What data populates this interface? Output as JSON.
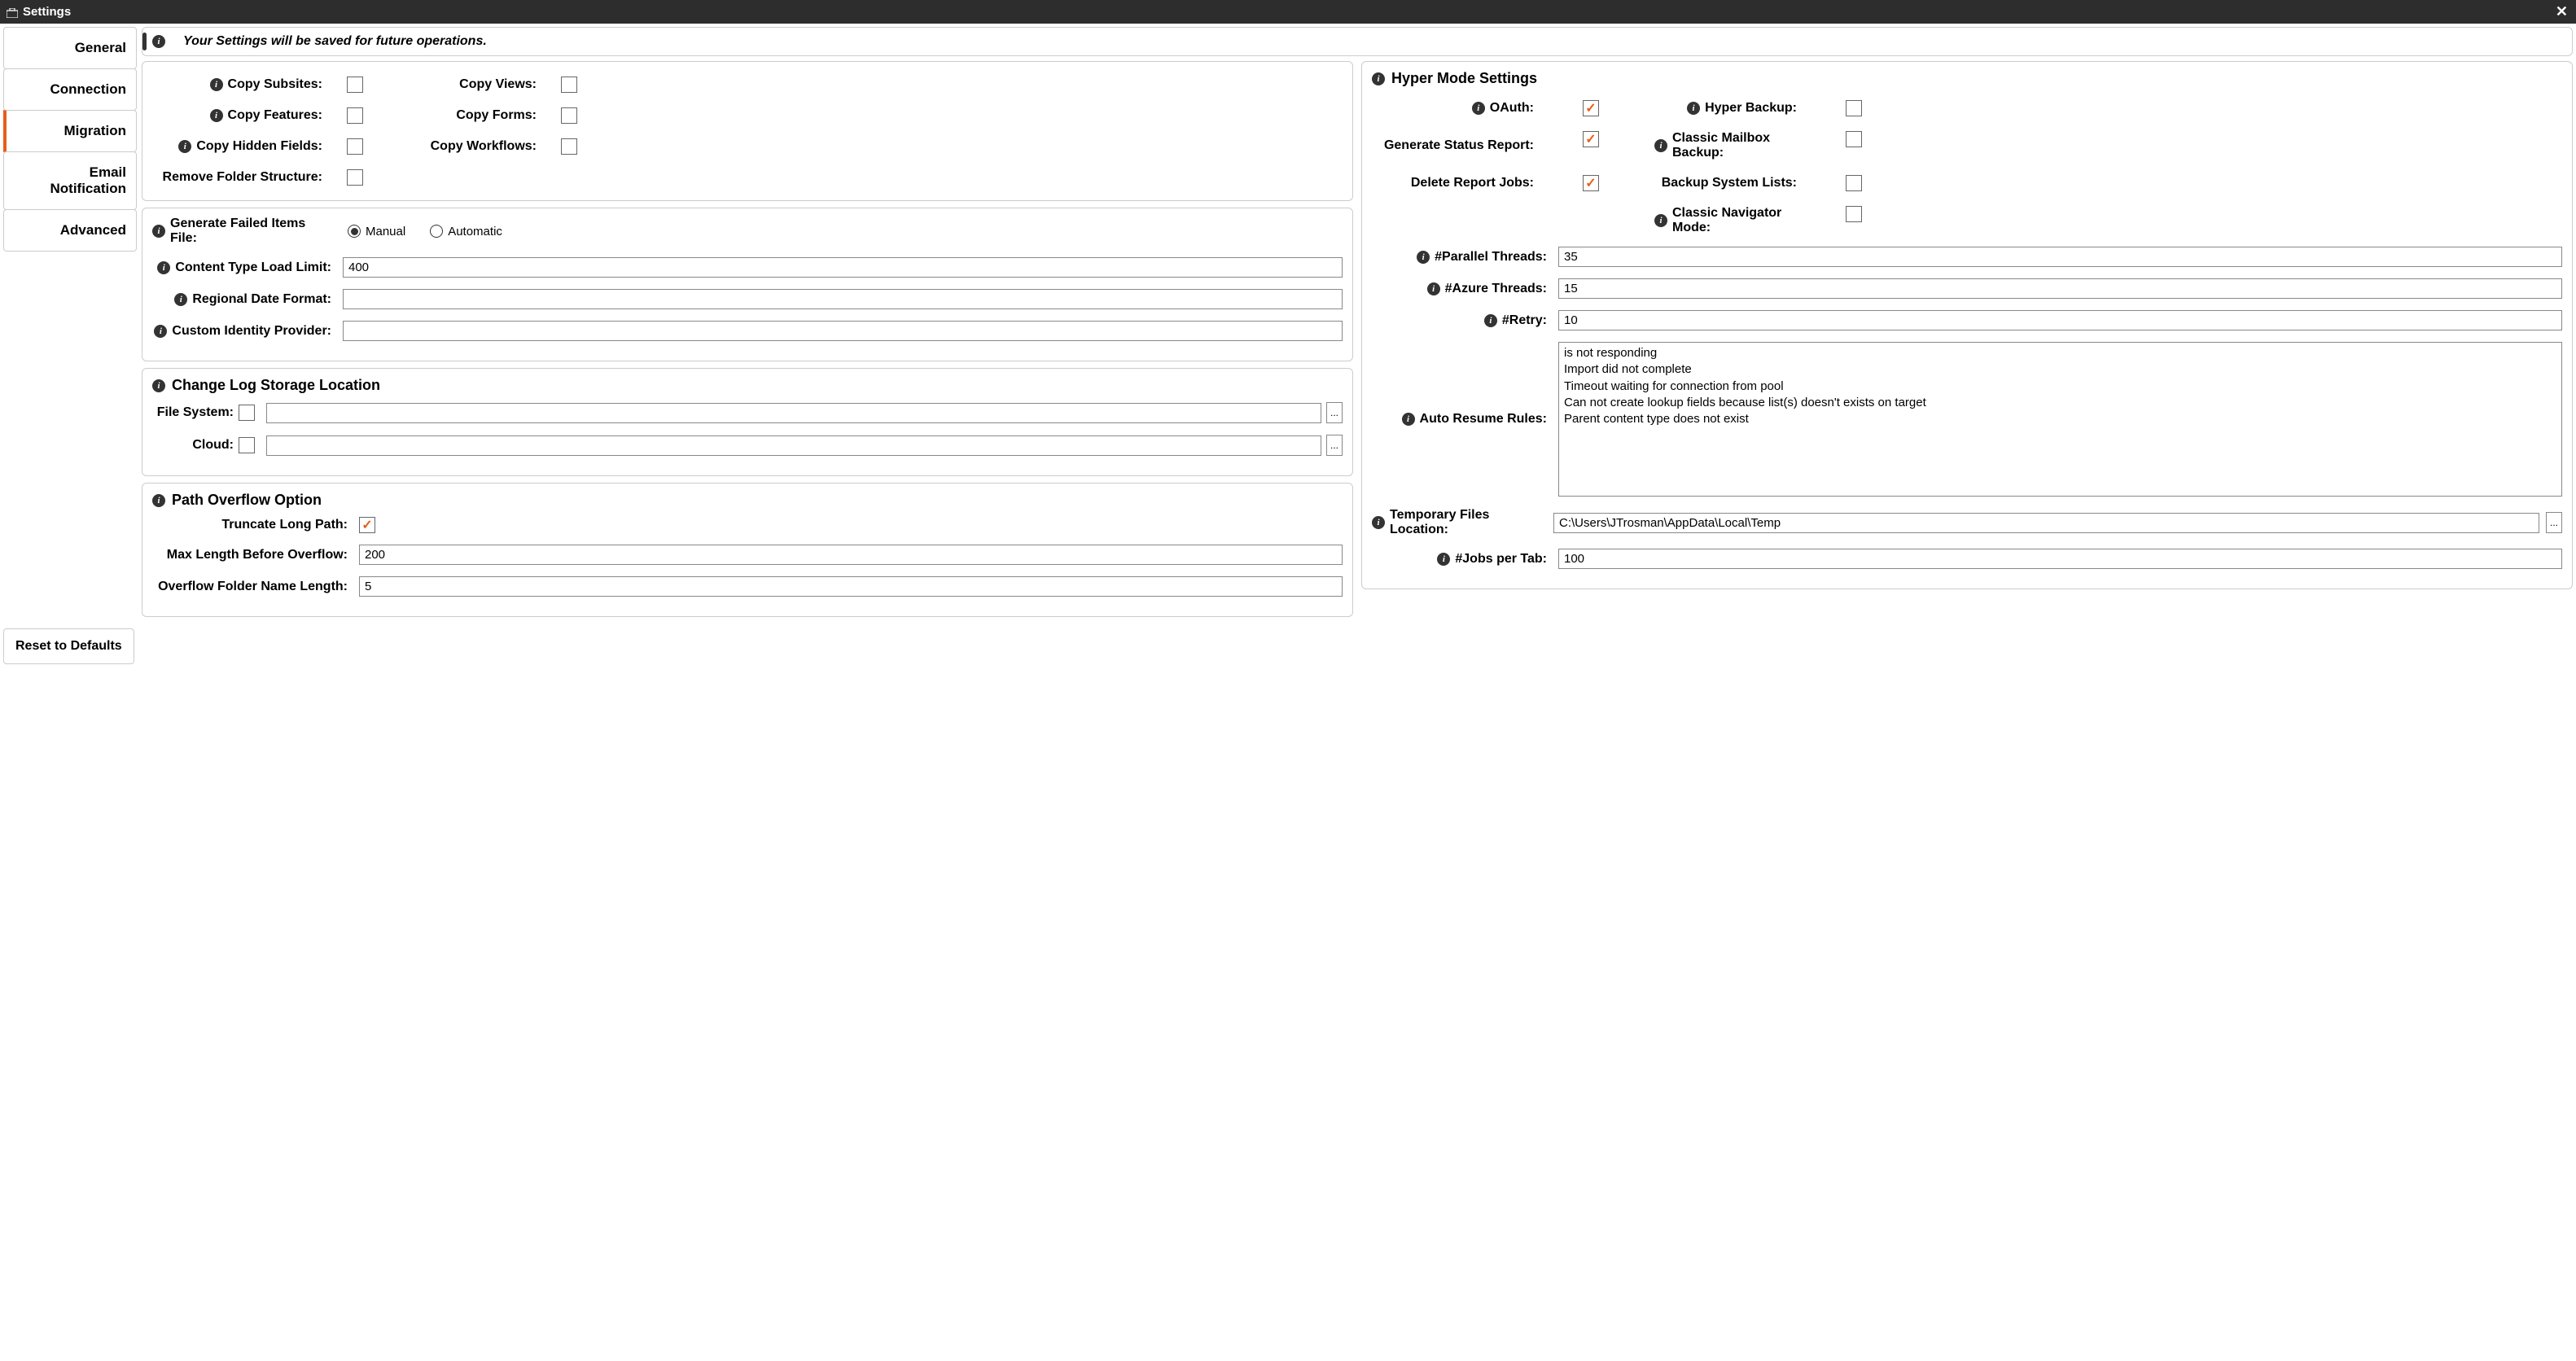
{
  "window": {
    "title": "Settings"
  },
  "banner": {
    "message": "Your Settings will be saved for future operations."
  },
  "sidebar": {
    "tabs": {
      "general": "General",
      "connection": "Connection",
      "migration": "Migration",
      "email": "Email Notification",
      "advanced": "Advanced"
    },
    "active": "migration"
  },
  "copy": {
    "subsites": "Copy Subsites:",
    "features": "Copy Features:",
    "hidden": "Copy Hidden Fields:",
    "remove": "Remove Folder Structure:",
    "views": "Copy Views:",
    "forms": "Copy Forms:",
    "workflows": "Copy Workflows:"
  },
  "failed": {
    "label": "Generate Failed Items File:",
    "manual": "Manual",
    "automatic": "Automatic",
    "selected": "manual",
    "content_type_label": "Content Type Load Limit:",
    "content_type_value": "400",
    "regional_label": "Regional Date Format:",
    "regional_value": "",
    "custom_idp_label": "Custom Identity Provider:",
    "custom_idp_value": ""
  },
  "changelog": {
    "title": "Change Log Storage Location",
    "fs_label": "File System:",
    "fs_value": "",
    "cloud_label": "Cloud:",
    "cloud_value": ""
  },
  "pathoverflow": {
    "title": "Path Overflow Option",
    "truncate_label": "Truncate Long Path:",
    "truncate_checked": true,
    "max_label": "Max Length Before Overflow:",
    "max_value": "200",
    "folder_label": "Overflow Folder Name Length:",
    "folder_value": "5"
  },
  "hyper": {
    "title": "Hyper Mode Settings",
    "oauth_label": "OAuth:",
    "oauth_checked": true,
    "status_label": "Generate Status Report:",
    "status_checked": true,
    "delete_label": "Delete Report Jobs:",
    "delete_checked": true,
    "backup_label": "Hyper Backup:",
    "backup_checked": false,
    "mailbox_label": "Classic Mailbox Backup:",
    "mailbox_checked": false,
    "syslists_label": "Backup System Lists:",
    "syslists_checked": false,
    "nav_label": "Classic Navigator Mode:",
    "nav_checked": false,
    "parallel_label": "#Parallel Threads:",
    "parallel_value": "35",
    "azure_label": "#Azure Threads:",
    "azure_value": "15",
    "retry_label": "#Retry:",
    "retry_value": "10",
    "rules_label": "Auto Resume Rules:",
    "rules_value": "is not responding\nImport did not complete\nTimeout waiting for connection from pool\nCan not create lookup fields because list(s) doesn't exists on target\nParent content type does not exist",
    "temp_label": "Temporary Files Location:",
    "temp_value": "C:\\Users\\JTrosman\\AppData\\Local\\Temp",
    "jobs_label": "#Jobs per Tab:",
    "jobs_value": "100"
  },
  "reset": {
    "label": "Reset to Defaults"
  }
}
